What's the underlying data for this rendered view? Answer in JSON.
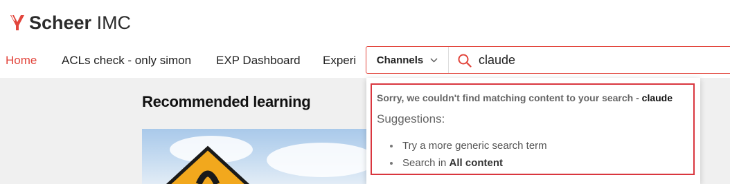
{
  "brand": {
    "name_bold": "Scheer",
    "name_rest": " IMC",
    "accent": "#e2453c"
  },
  "nav": {
    "items": [
      {
        "label": "Home",
        "active": true
      },
      {
        "label": "ACLs check - only simon",
        "active": false
      },
      {
        "label": "EXP Dashboard",
        "active": false
      },
      {
        "label": "Experi",
        "active": false
      }
    ]
  },
  "search": {
    "scope_label": "Channels",
    "query": "claude",
    "scope_icon": "chevron-down-icon",
    "icon": "search-icon"
  },
  "results": {
    "no_match_text": "Sorry, we couldn't find matching content to your search - ",
    "term": "claude",
    "suggestions_title": "Suggestions:",
    "suggestion_1": "Try a more generic search term",
    "suggestion_2_prefix": "Search in ",
    "suggestion_2_link": "All content"
  },
  "main": {
    "section_title": "Recommended learning"
  }
}
